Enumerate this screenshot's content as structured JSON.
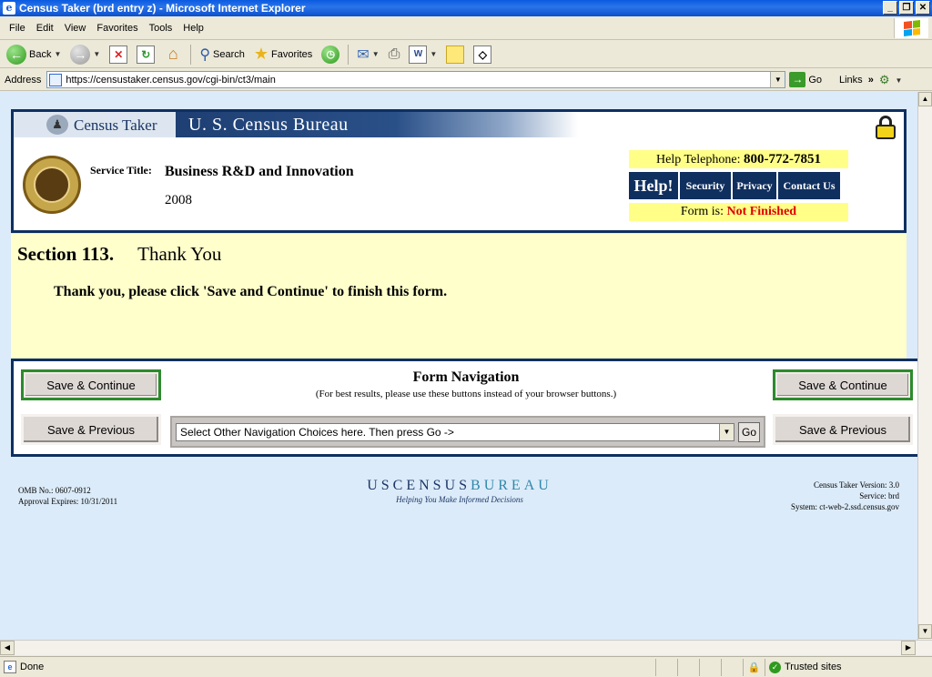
{
  "window": {
    "title": "Census Taker (brd entry z) - Microsoft Internet Explorer",
    "minimize": "_",
    "maximize": "❐",
    "close": "✕"
  },
  "menu": [
    "File",
    "Edit",
    "View",
    "Favorites",
    "Tools",
    "Help"
  ],
  "toolbar": {
    "back_label": "Back",
    "search_label": "Search",
    "favorites_label": "Favorites"
  },
  "address": {
    "label": "Address",
    "url": "https://censustaker.census.gov/cgi-bin/ct3/main",
    "go_label": "Go",
    "links_label": "Links"
  },
  "header": {
    "app_name": "Census Taker",
    "bureau": "U. S. Census Bureau",
    "service_label": "Service Title:",
    "service_title": "Business R&D and Innovation",
    "year": "2008",
    "help_tel_label": "Help Telephone:",
    "help_tel_number": "800-772-7851",
    "help_button": "Help!",
    "security_button": "Security",
    "privacy_button": "Privacy",
    "contact_button": "Contact Us",
    "form_status_label": "Form is:",
    "form_status_value": "Not Finished"
  },
  "section": {
    "number": "Section 113.",
    "title": "Thank You",
    "message": "Thank you, please click 'Save and Continue' to finish this form."
  },
  "navigation": {
    "title": "Form Navigation",
    "subtitle": "(For best results, please use these buttons instead of your browser buttons.)",
    "save_continue": "Save & Continue",
    "save_previous": "Save & Previous",
    "select_value": "Select Other Navigation Choices here. Then press Go ->",
    "go": "Go"
  },
  "footer": {
    "omb": "OMB No.: 0607-0912",
    "approval": "Approval Expires: 10/31/2011",
    "logo_uscensus": "USCENSUS",
    "logo_bureau": "BUREAU",
    "tagline": "Helping You Make Informed Decisions",
    "version": "Census Taker Version: 3.0",
    "service": "Service: brd",
    "system": "System: ct-web-2.ssd.census.gov"
  },
  "status": {
    "text": "Done",
    "zone": "Trusted sites"
  }
}
